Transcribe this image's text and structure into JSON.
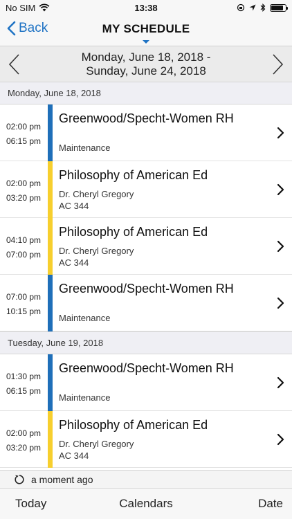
{
  "status_bar": {
    "carrier": "No SIM",
    "time": "13:38"
  },
  "nav": {
    "back_label": "Back",
    "title": "MY SCHEDULE"
  },
  "week": {
    "range_line1": "Monday, June 18, 2018 -",
    "range_line2": "Sunday, June 24, 2018"
  },
  "colors": {
    "accent": "#1f73c4",
    "blue_event": "#1f6fb9",
    "yellow_event": "#f7cf2e"
  },
  "days": [
    {
      "header": "Monday, June 18, 2018",
      "events": [
        {
          "start": "02:00 pm",
          "end": "06:15 pm",
          "title": "Greenwood/Specht-Women RH",
          "line1": "",
          "line2": "Maintenance",
          "color": "blue"
        },
        {
          "start": "02:00 pm",
          "end": "03:20 pm",
          "title": "Philosophy of American Ed",
          "line1": "Dr. Cheryl Gregory",
          "line2": "AC 344",
          "color": "yellow"
        },
        {
          "start": "04:10 pm",
          "end": "07:00 pm",
          "title": "Philosophy of American Ed",
          "line1": "Dr. Cheryl Gregory",
          "line2": "AC 344",
          "color": "yellow"
        },
        {
          "start": "07:00 pm",
          "end": "10:15 pm",
          "title": "Greenwood/Specht-Women RH",
          "line1": "",
          "line2": "Maintenance",
          "color": "blue"
        }
      ]
    },
    {
      "header": "Tuesday, June 19, 2018",
      "events": [
        {
          "start": "01:30 pm",
          "end": "06:15 pm",
          "title": "Greenwood/Specht-Women RH",
          "line1": "",
          "line2": "Maintenance",
          "color": "blue"
        },
        {
          "start": "02:00 pm",
          "end": "03:20 pm",
          "title": "Philosophy of American Ed",
          "line1": "Dr. Cheryl Gregory",
          "line2": "AC 344",
          "color": "yellow"
        }
      ]
    }
  ],
  "refresh": {
    "label": "a moment ago"
  },
  "toolbar": {
    "today": "Today",
    "calendars": "Calendars",
    "date": "Date"
  }
}
